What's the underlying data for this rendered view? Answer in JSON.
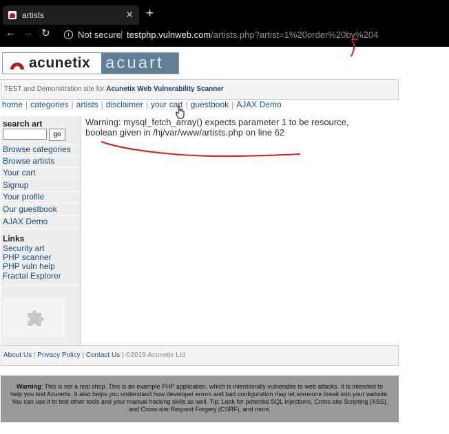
{
  "browser": {
    "tab_title": "artists",
    "tab_close": "✕",
    "new_tab": "+",
    "back": "←",
    "forward": "→",
    "reload": "↻",
    "info": "i",
    "security": "Not secure",
    "separator": "|",
    "url_host": "testphp.vulnweb.com",
    "url_path": "/artists.php?artist=1%20order%20by%204"
  },
  "brand": {
    "logo_text": "acunetix",
    "logo_sub": "acuart"
  },
  "tagline": {
    "prefix": "TEST and Demonstration site for ",
    "bold": "Acunetix Web Vulnerability Scanner"
  },
  "topnav": {
    "items": [
      "home",
      "categories",
      "artists",
      "disclaimer",
      "your cart",
      "guestbook",
      "AJAX Demo"
    ],
    "separator": "|"
  },
  "sidebar": {
    "search_label": "search art",
    "search_value": "",
    "go_label": "go",
    "nav": [
      "Browse categories",
      "Browse artists",
      "Your cart",
      "Signup",
      "Your profile",
      "Our guestbook",
      "AJAX Demo"
    ],
    "links_title": "Links",
    "links": [
      "Security art",
      "PHP scanner",
      "PHP vuln help",
      "Fractal Explorer"
    ]
  },
  "main": {
    "warning": "Warning: mysql_fetch_array() expects parameter 1 to be resource, boolean given in /hj/var/www/artists.php on line 62"
  },
  "footer": {
    "about": "About Us",
    "privacy": "Privacy Policy",
    "contact": "Contact Us",
    "sep": " | ",
    "copyright": "©2019 Acunetix Ltd"
  },
  "disclaimer": {
    "bold": "Warning",
    "text": ": This is not a real shop. This is an example PHP application, which is intentionally vulnerable to web attacks. It is intended to help you test Acunetix. It also helps you understand how developer errors and bad configuration may let someone break into your website. You can use it to test other tools and your manual hacking skills as well. Tip: Look for potential SQL Injections, Cross-site Scripting (XSS), and Cross-site Request Forgery (CSRF), and more."
  },
  "colors": {
    "link": "#1b4d7a",
    "annotation": "#d81c1c",
    "chrome_bg": "#000000",
    "logo_band": "#5f7f95"
  }
}
